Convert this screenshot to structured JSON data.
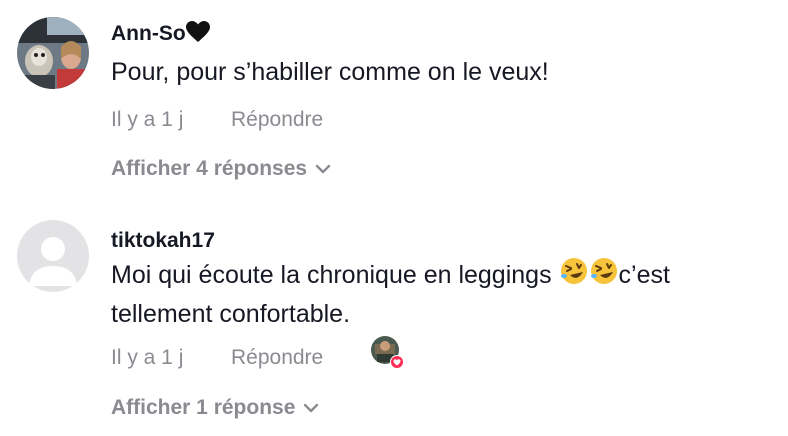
{
  "comments": [
    {
      "username": "Ann-So",
      "username_emoji": "black-heart",
      "text": "Pour, pour s’habiller comme on le veux!",
      "time": "Il y a 1 j",
      "reply_label": "Répondre",
      "more_replies": "Afficher 4 réponses"
    },
    {
      "username": "tiktokah17",
      "text_before": "Moi qui écoute la chronique en leggings ",
      "text_emoji": "rolling-on-floor-laughing x2",
      "text_after": "c’est tellement confortable.",
      "time": "Il y a 1 j",
      "reply_label": "Répondre",
      "creator_liked": true,
      "more_replies": "Afficher 1 réponse"
    }
  ],
  "colors": {
    "primary_text": "#161823",
    "secondary_text": "#8a8b91",
    "like_badge": "#fe2c55"
  }
}
